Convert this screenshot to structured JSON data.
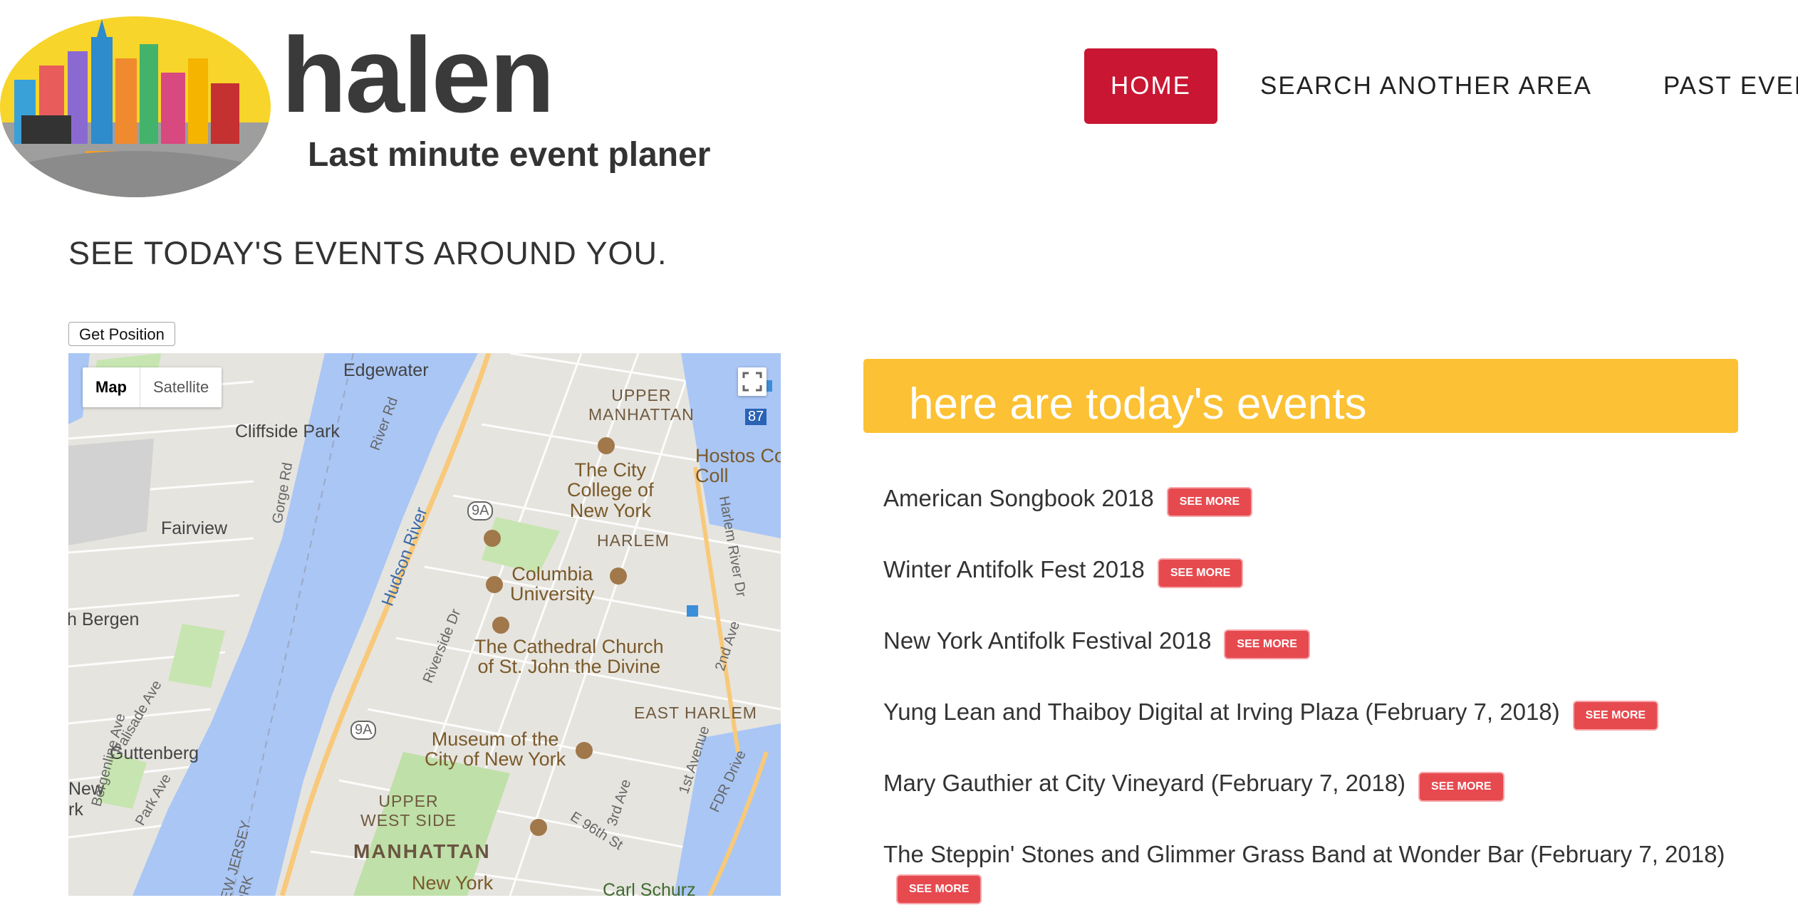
{
  "header": {
    "brand": "halen",
    "tagline": "Last minute event planer"
  },
  "nav": {
    "home": "HOME",
    "search": "SEARCH ANOTHER AREA",
    "past": "PAST EVENTS",
    "accent_color": "#c91633"
  },
  "main": {
    "heading": "SEE TODAY'S EVENTS AROUND YOU.",
    "get_position": "Get Position"
  },
  "map": {
    "type_map": "Map",
    "type_satellite": "Satellite",
    "labels": {
      "edgewater": "Edgewater",
      "upper_manhattan": "UPPER\nMANHATTAN",
      "cliffside_park": "Cliffside Park",
      "river_rd": "River Rd",
      "gorge_rd": "Gorge Rd",
      "city_college": "The City\nCollege of\nNew York",
      "hostos": "Hostos Co\nColl",
      "fairview": "Fairview",
      "harlem": "HARLEM",
      "hudson_river": "Hudson River",
      "columbia": "Columbia\nUniversity",
      "harlem_river_dr": "Harlem River Dr",
      "north_bergen": "h Bergen",
      "riverside_dr": "Riverside Dr",
      "cathedral": "The Cathedral Church\nof St. John the Divine",
      "second_ave": "2nd Ave",
      "east_harlem": "EAST HARLEM",
      "guttenberg": "Guttenberg",
      "museum": "Museum of the\nCity of New York",
      "first_ave": "1st Avenue",
      "fdr": "FDR Drive",
      "new_york_l": "New\nrk",
      "upper_west_side": "UPPER\nWEST SIDE",
      "third_ave": "3rd Ave",
      "e96": "E 96th St",
      "manhattan": "MANHATTAN",
      "new_york": "New York",
      "carl_schurz": "Carl Schurz",
      "route_9a": "9A",
      "route_87": "87",
      "bergenline": "Bergenline Ave",
      "palisade": "Palisade Ave",
      "park_ave": "Park Ave",
      "new_jersey": "NEW JERSEY\nYORK"
    }
  },
  "events": {
    "title": "here are today's events",
    "banner_color": "#fcc134",
    "see_more_label": "SEE MORE",
    "items": [
      {
        "name": "American Songbook 2018"
      },
      {
        "name": "Winter Antifolk Fest 2018"
      },
      {
        "name": "New York Antifolk Festival 2018"
      },
      {
        "name": "Yung Lean and Thaiboy Digital at Irving Plaza (February 7, 2018)"
      },
      {
        "name": "Mary Gauthier at City Vineyard (February 7, 2018)"
      },
      {
        "name": "The Steppin' Stones and Glimmer Grass Band at Wonder Bar (February 7, 2018)"
      }
    ]
  }
}
